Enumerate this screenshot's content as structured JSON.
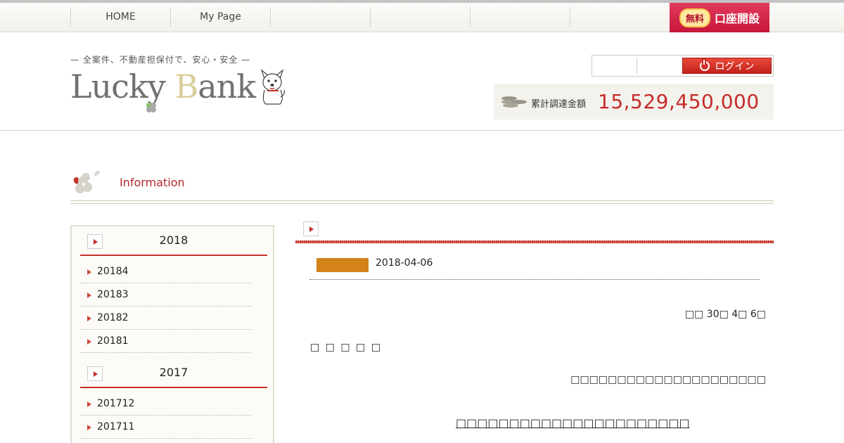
{
  "nav": {
    "items": [
      {
        "label": "HOME"
      },
      {
        "label": "My Page"
      },
      {
        "label": ""
      },
      {
        "label": ""
      },
      {
        "label": ""
      }
    ],
    "open_account": {
      "badge": "無料",
      "label": "口座開設"
    }
  },
  "header": {
    "tagline": "— 全案件、不動産担保付で、安心・安全 —",
    "logo": {
      "part1": "Lucky ",
      "part2": "B",
      "part3": "ank"
    },
    "login_label": "ログイン",
    "total_label": "累計調達金額",
    "total_value": "15,529,450,000"
  },
  "info": {
    "title": "Information"
  },
  "sidebar": {
    "years": [
      {
        "label": "2018",
        "months": [
          "20184",
          "20183",
          "20182",
          "20181"
        ]
      },
      {
        "label": "2017",
        "months": [
          "201712",
          "201711"
        ]
      }
    ]
  },
  "post": {
    "category": "",
    "date": "2018-04-06",
    "doc_date": "□□ 30□ 4□ 6□",
    "addressee": "□ □ □ □ □",
    "sender": "□□□□□□□□□□□□□□□□□□□□□",
    "heading": "□□□□□□□□□□□□□□□□□□□□□□"
  },
  "colors": {
    "accent": "#c3332c",
    "category": "#d4821a",
    "total": "#c52a2a"
  }
}
